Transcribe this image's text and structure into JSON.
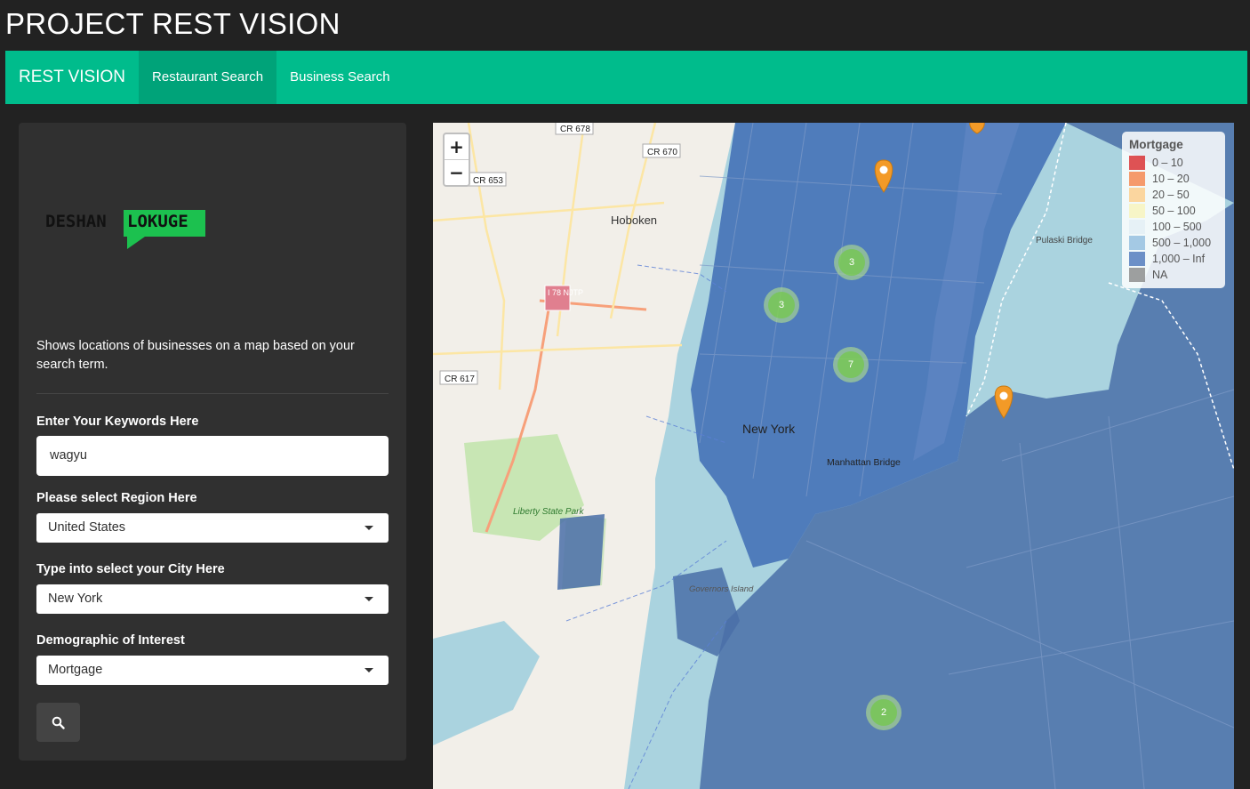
{
  "app": {
    "title": "PROJECT REST VISION"
  },
  "navbar": {
    "brand": "REST VISION",
    "tabs": [
      {
        "label": "Restaurant Search",
        "active": true
      },
      {
        "label": "Business Search",
        "active": false
      }
    ]
  },
  "sidebar": {
    "logo_text_1": "DESHAN",
    "logo_text_2": "LOKUGE",
    "description": "Shows locations of businesses on a map based on your search term.",
    "keywords": {
      "label": "Enter Your Keywords Here",
      "value": "wagyu"
    },
    "region": {
      "label": "Please select Region Here",
      "value": "United States"
    },
    "city": {
      "label": "Type into select your City Here",
      "value": "New York"
    },
    "demographic": {
      "label": "Demographic of Interest",
      "value": "Mortgage"
    },
    "search_icon": "search-icon"
  },
  "map": {
    "zoom_in": "+",
    "zoom_out": "−",
    "labels": {
      "hoboken": "Hoboken",
      "new_york": "New York",
      "manhattan_bridge": "Manhattan Bridge",
      "liberty_state_park": "Liberty State Park",
      "governors_island": "Governors Island",
      "pulaski_bridge": "Pulaski Bridge",
      "cr678": "CR 678",
      "cr670": "CR 670",
      "cr653": "CR 653",
      "cr617": "CR 617",
      "i78": "I 78 NJTP"
    },
    "clusters": [
      {
        "count": "3"
      },
      {
        "count": "3"
      },
      {
        "count": "7"
      },
      {
        "count": "2"
      }
    ],
    "legend": {
      "title": "Mortgage",
      "items": [
        {
          "label": "0 – 10",
          "color": "#d7191c"
        },
        {
          "label": "10 – 20",
          "color": "#f57a3c"
        },
        {
          "label": "20 – 50",
          "color": "#fdc980"
        },
        {
          "label": "50 – 100",
          "color": "#f8f3b6"
        },
        {
          "label": "100 – 500",
          "color": "#e1eef4"
        },
        {
          "label": "500 – 1,000",
          "color": "#8ab8dc"
        },
        {
          "label": "1,000 – Inf",
          "color": "#3f6cb5"
        },
        {
          "label": "NA",
          "color": "#808080"
        }
      ]
    }
  }
}
